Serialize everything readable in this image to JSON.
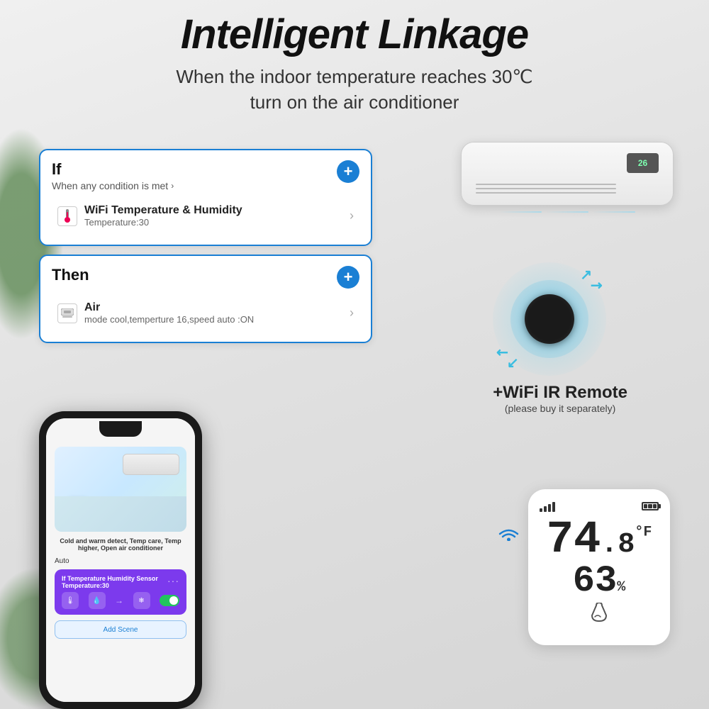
{
  "page": {
    "background_color": "#e0e0e0",
    "title": "Intelligent Linkage",
    "subtitle_line1": "When the indoor temperature reaches 30℃",
    "subtitle_line2": "turn on the air conditioner"
  },
  "if_card": {
    "label": "If",
    "condition": "When any condition is met",
    "condition_chevron": "›",
    "add_icon": "+",
    "item": {
      "name": "WiFi Temperature & Humidity",
      "detail": "Temperature:30",
      "chevron": "›"
    }
  },
  "then_card": {
    "label": "Then",
    "add_icon": "+",
    "item": {
      "name": "Air",
      "detail": "mode cool,temperture 16,speed auto :ON",
      "chevron": "›"
    }
  },
  "ir_remote": {
    "label": "+WiFi IR Remote",
    "sublabel": "(please buy it separately)"
  },
  "sensor": {
    "temperature": "74",
    "temperature_decimal": ".8",
    "temperature_unit": "°F",
    "humidity": "63",
    "humidity_unit": "%"
  },
  "ac_display_value": "26",
  "phone": {
    "caption": "Cold and warm detect, Temp care, Temp higher,\nOpen air conditioner",
    "auto_label": "Auto",
    "automation_title": "If Temperature Humidity Sensor\nTemperature:30",
    "more_dots": "···",
    "add_scene_label": "Add Scene"
  }
}
